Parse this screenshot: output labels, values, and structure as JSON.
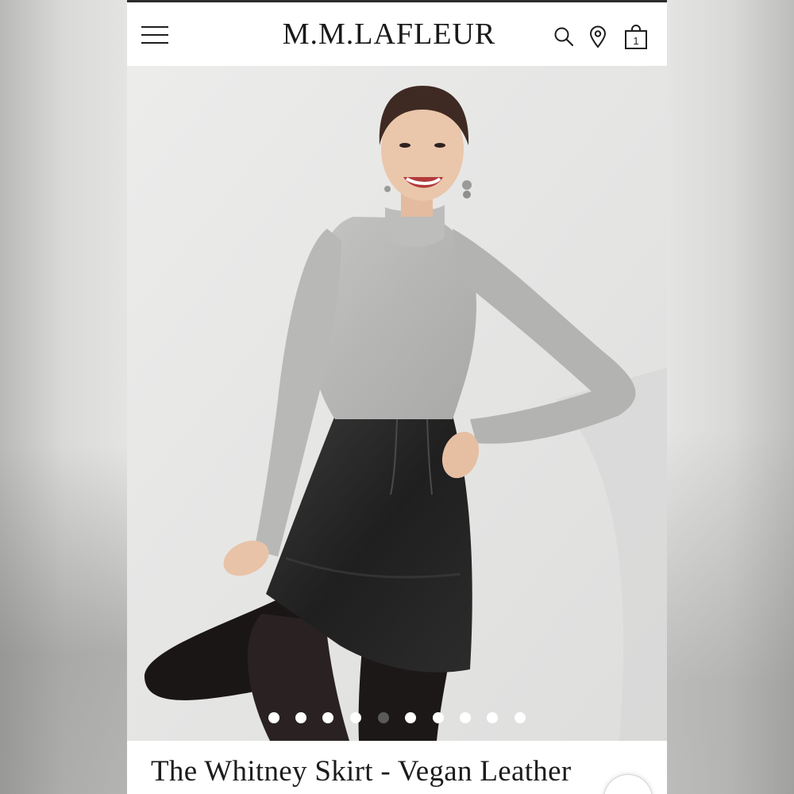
{
  "header": {
    "brand": "M.M.LAFLEUR",
    "menu_icon": "hamburger-menu-icon",
    "search_icon": "search-icon",
    "store_icon": "location-pin-icon",
    "bag_icon": "shopping-bag-icon",
    "bag_count": "1"
  },
  "hero": {
    "image_alt": "Model wearing grey turtleneck and black vegan leather skirt",
    "carousel": {
      "total": 10,
      "active_index": 4
    }
  },
  "product": {
    "title": "The Whitney Skirt - Vegan Leather"
  }
}
